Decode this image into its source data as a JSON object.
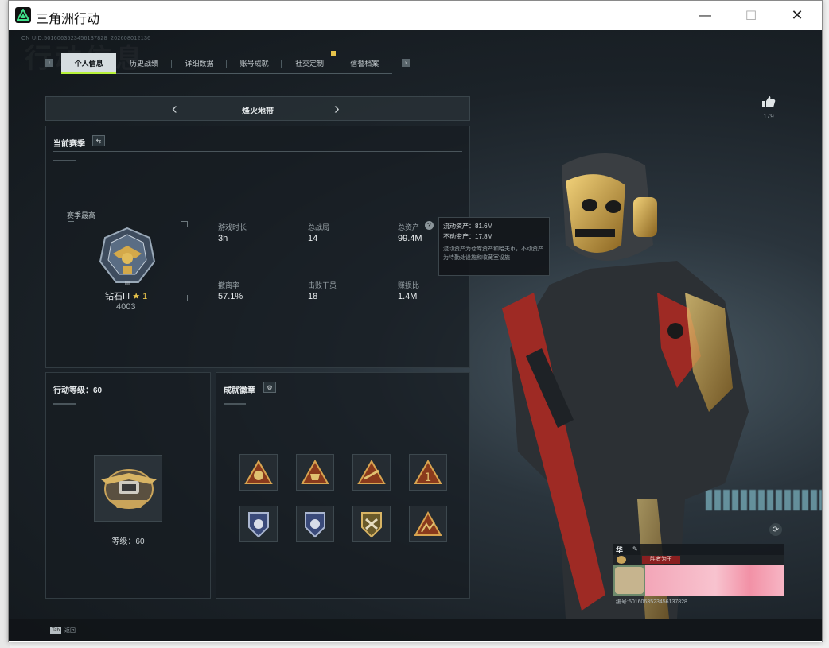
{
  "window": {
    "title": "三角洲行动",
    "minimize": "—",
    "maximize": "☐",
    "close": "✕"
  },
  "game": {
    "uid_line": "CN UID:5016063523456137828_202608012136",
    "watermark": "行动信息",
    "tabs": [
      "个人信息",
      "历史战绩",
      "详细数据",
      "账号成就",
      "社交定制",
      "信誉档案"
    ],
    "active_tab": 0,
    "mode": {
      "title": "烽火地带"
    },
    "season": {
      "header": "当前赛季",
      "best_label": "赛季最高",
      "rank_name": "钻石III",
      "rank_stars": "★ 1",
      "rank_score": "4003",
      "stats": [
        {
          "label": "游戏时长",
          "value": "3h"
        },
        {
          "label": "总战局",
          "value": "14"
        },
        {
          "label": "总资产",
          "value": "99.4M"
        },
        {
          "label": "撤离率",
          "value": "57.1%"
        },
        {
          "label": "击败干员",
          "value": "18"
        },
        {
          "label": "赚损比",
          "value": "1.4M"
        }
      ]
    },
    "tooltip": {
      "line1": "流动资产：81.6M",
      "line2": "不动资产：17.8M",
      "desc": "流动资产为仓库资产和哈夫币，不动资产为特勤处设施和收藏室设施"
    },
    "level": {
      "header": "行动等级：60",
      "label": "等级：60"
    },
    "badges": {
      "header": "成就徽章"
    },
    "like_count": "179",
    "card": {
      "name": "华",
      "title": "胜者为王",
      "uid": "编号:5016063523456137828"
    },
    "bottom": {
      "key": "Tab",
      "label": "返回"
    }
  }
}
